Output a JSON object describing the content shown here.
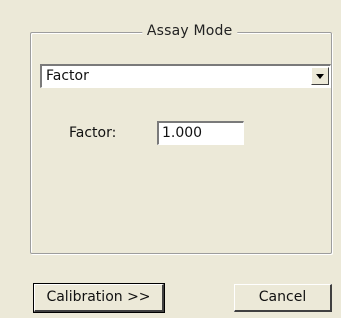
{
  "group": {
    "title": "Assay Mode"
  },
  "mode_select": {
    "value": "Factor"
  },
  "factor": {
    "label": "Factor:",
    "value": "1.000"
  },
  "buttons": {
    "calibration": "Calibration  >>",
    "cancel": "Cancel"
  }
}
